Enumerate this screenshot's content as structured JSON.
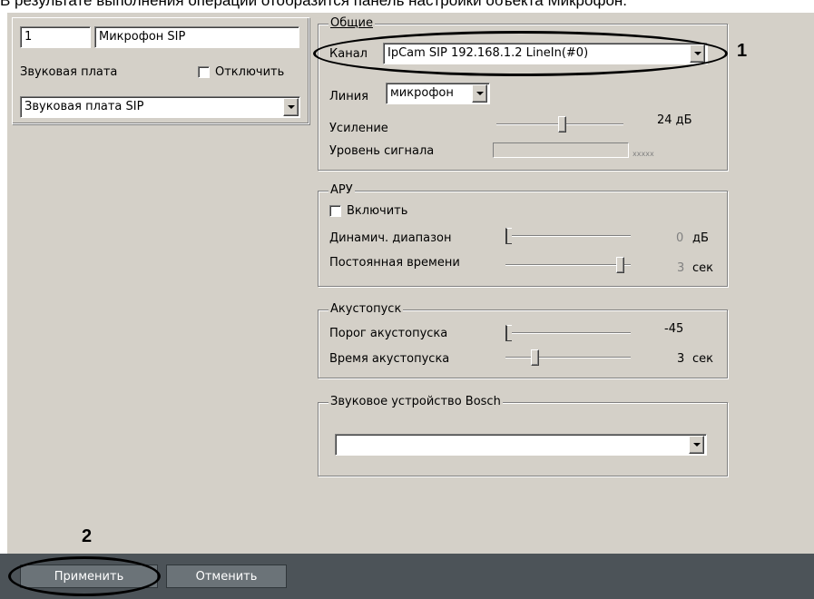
{
  "doc_text": "В результате выполнения операции отобразится панель настройки объекта Микрофон.",
  "device": {
    "id_value": "1",
    "name_value": "Микрофон SIP",
    "sound_card_label": "Звуковая плата",
    "disable_label": "Отключить",
    "disable_checked": false,
    "sound_card_value": "Звуковая плата SIP"
  },
  "general": {
    "legend": "Общие",
    "channel_label": "Канал",
    "channel_value": "IpCam SIP 192.168.1.2 LineIn(#0)",
    "line_label": "Линия",
    "line_value": "микрофон",
    "gain_label": "Усиление",
    "gain_value": "24 дБ",
    "signal_label": "Уровень сигнала",
    "signal_text": "xxxxx"
  },
  "agc": {
    "legend": "АРУ",
    "enable_label": "Включить",
    "enable_checked": false,
    "range_label": "Динамич. диапазон",
    "range_num": "0",
    "range_unit": "дБ",
    "time_label": "Постоянная времени",
    "time_num": "3",
    "time_unit": "сек"
  },
  "vox": {
    "legend": "Акустопуск",
    "threshold_label": "Порог акустопуска",
    "threshold_value": "-45",
    "time_label": "Время акустопуска",
    "time_num": "3",
    "time_unit": "сек"
  },
  "bosch": {
    "legend": "Звуковое устройство Bosch",
    "value": ""
  },
  "buttons": {
    "apply": "Применить",
    "cancel": "Отменить"
  },
  "callouts": {
    "one": "1",
    "two": "2"
  }
}
